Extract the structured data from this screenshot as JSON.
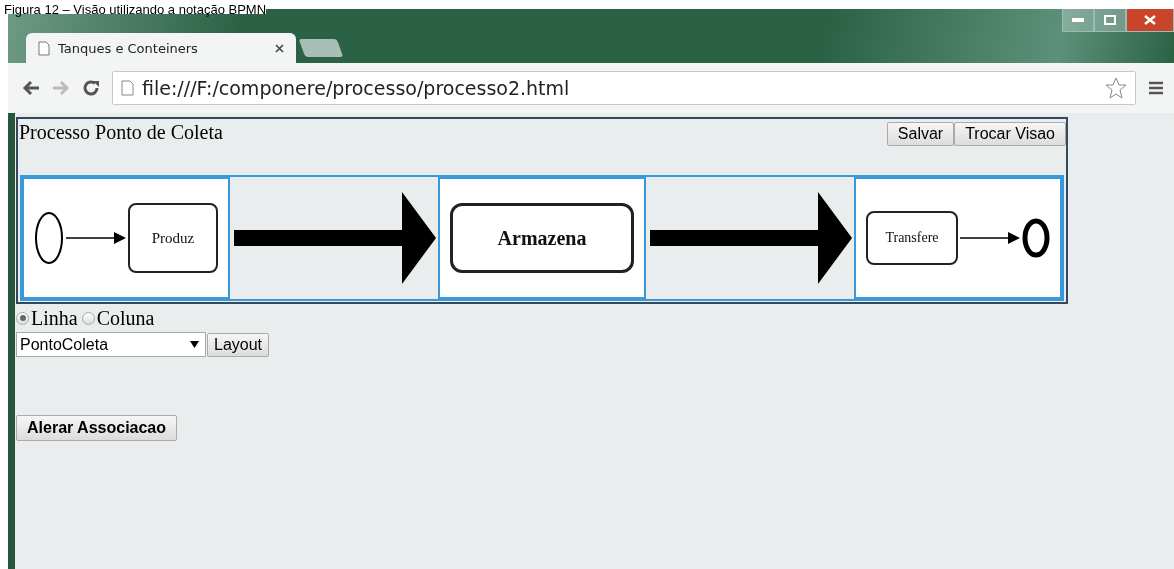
{
  "caption": "Figura 12 – Visão utilizando a notação BPMN",
  "browser": {
    "tab_title": "Tanques e Conteiners",
    "url": "file:///F:/componere/processo/processo2.html"
  },
  "panel": {
    "title": "Processo Ponto de Coleta",
    "buttons": [
      "Salvar",
      "Trocar Visao"
    ],
    "cells": [
      {
        "kind": "tasks",
        "items": [
          {
            "kind": "start"
          },
          {
            "kind": "task",
            "label": "Produz"
          }
        ]
      },
      {
        "kind": "flow"
      },
      {
        "kind": "tasks",
        "items": [
          {
            "kind": "task",
            "label": "Armazena"
          }
        ]
      },
      {
        "kind": "flow"
      },
      {
        "kind": "tasks",
        "items": [
          {
            "kind": "task",
            "label": "Transfere"
          },
          {
            "kind": "end"
          }
        ]
      }
    ]
  },
  "orientation": [
    {
      "label": "Linha",
      "selected": true
    },
    {
      "label": "Coluna",
      "selected": false
    }
  ],
  "process_select": {
    "value": "PontoColeta"
  },
  "layout_button": "Layout",
  "associate_button": "Alerar Associacao"
}
